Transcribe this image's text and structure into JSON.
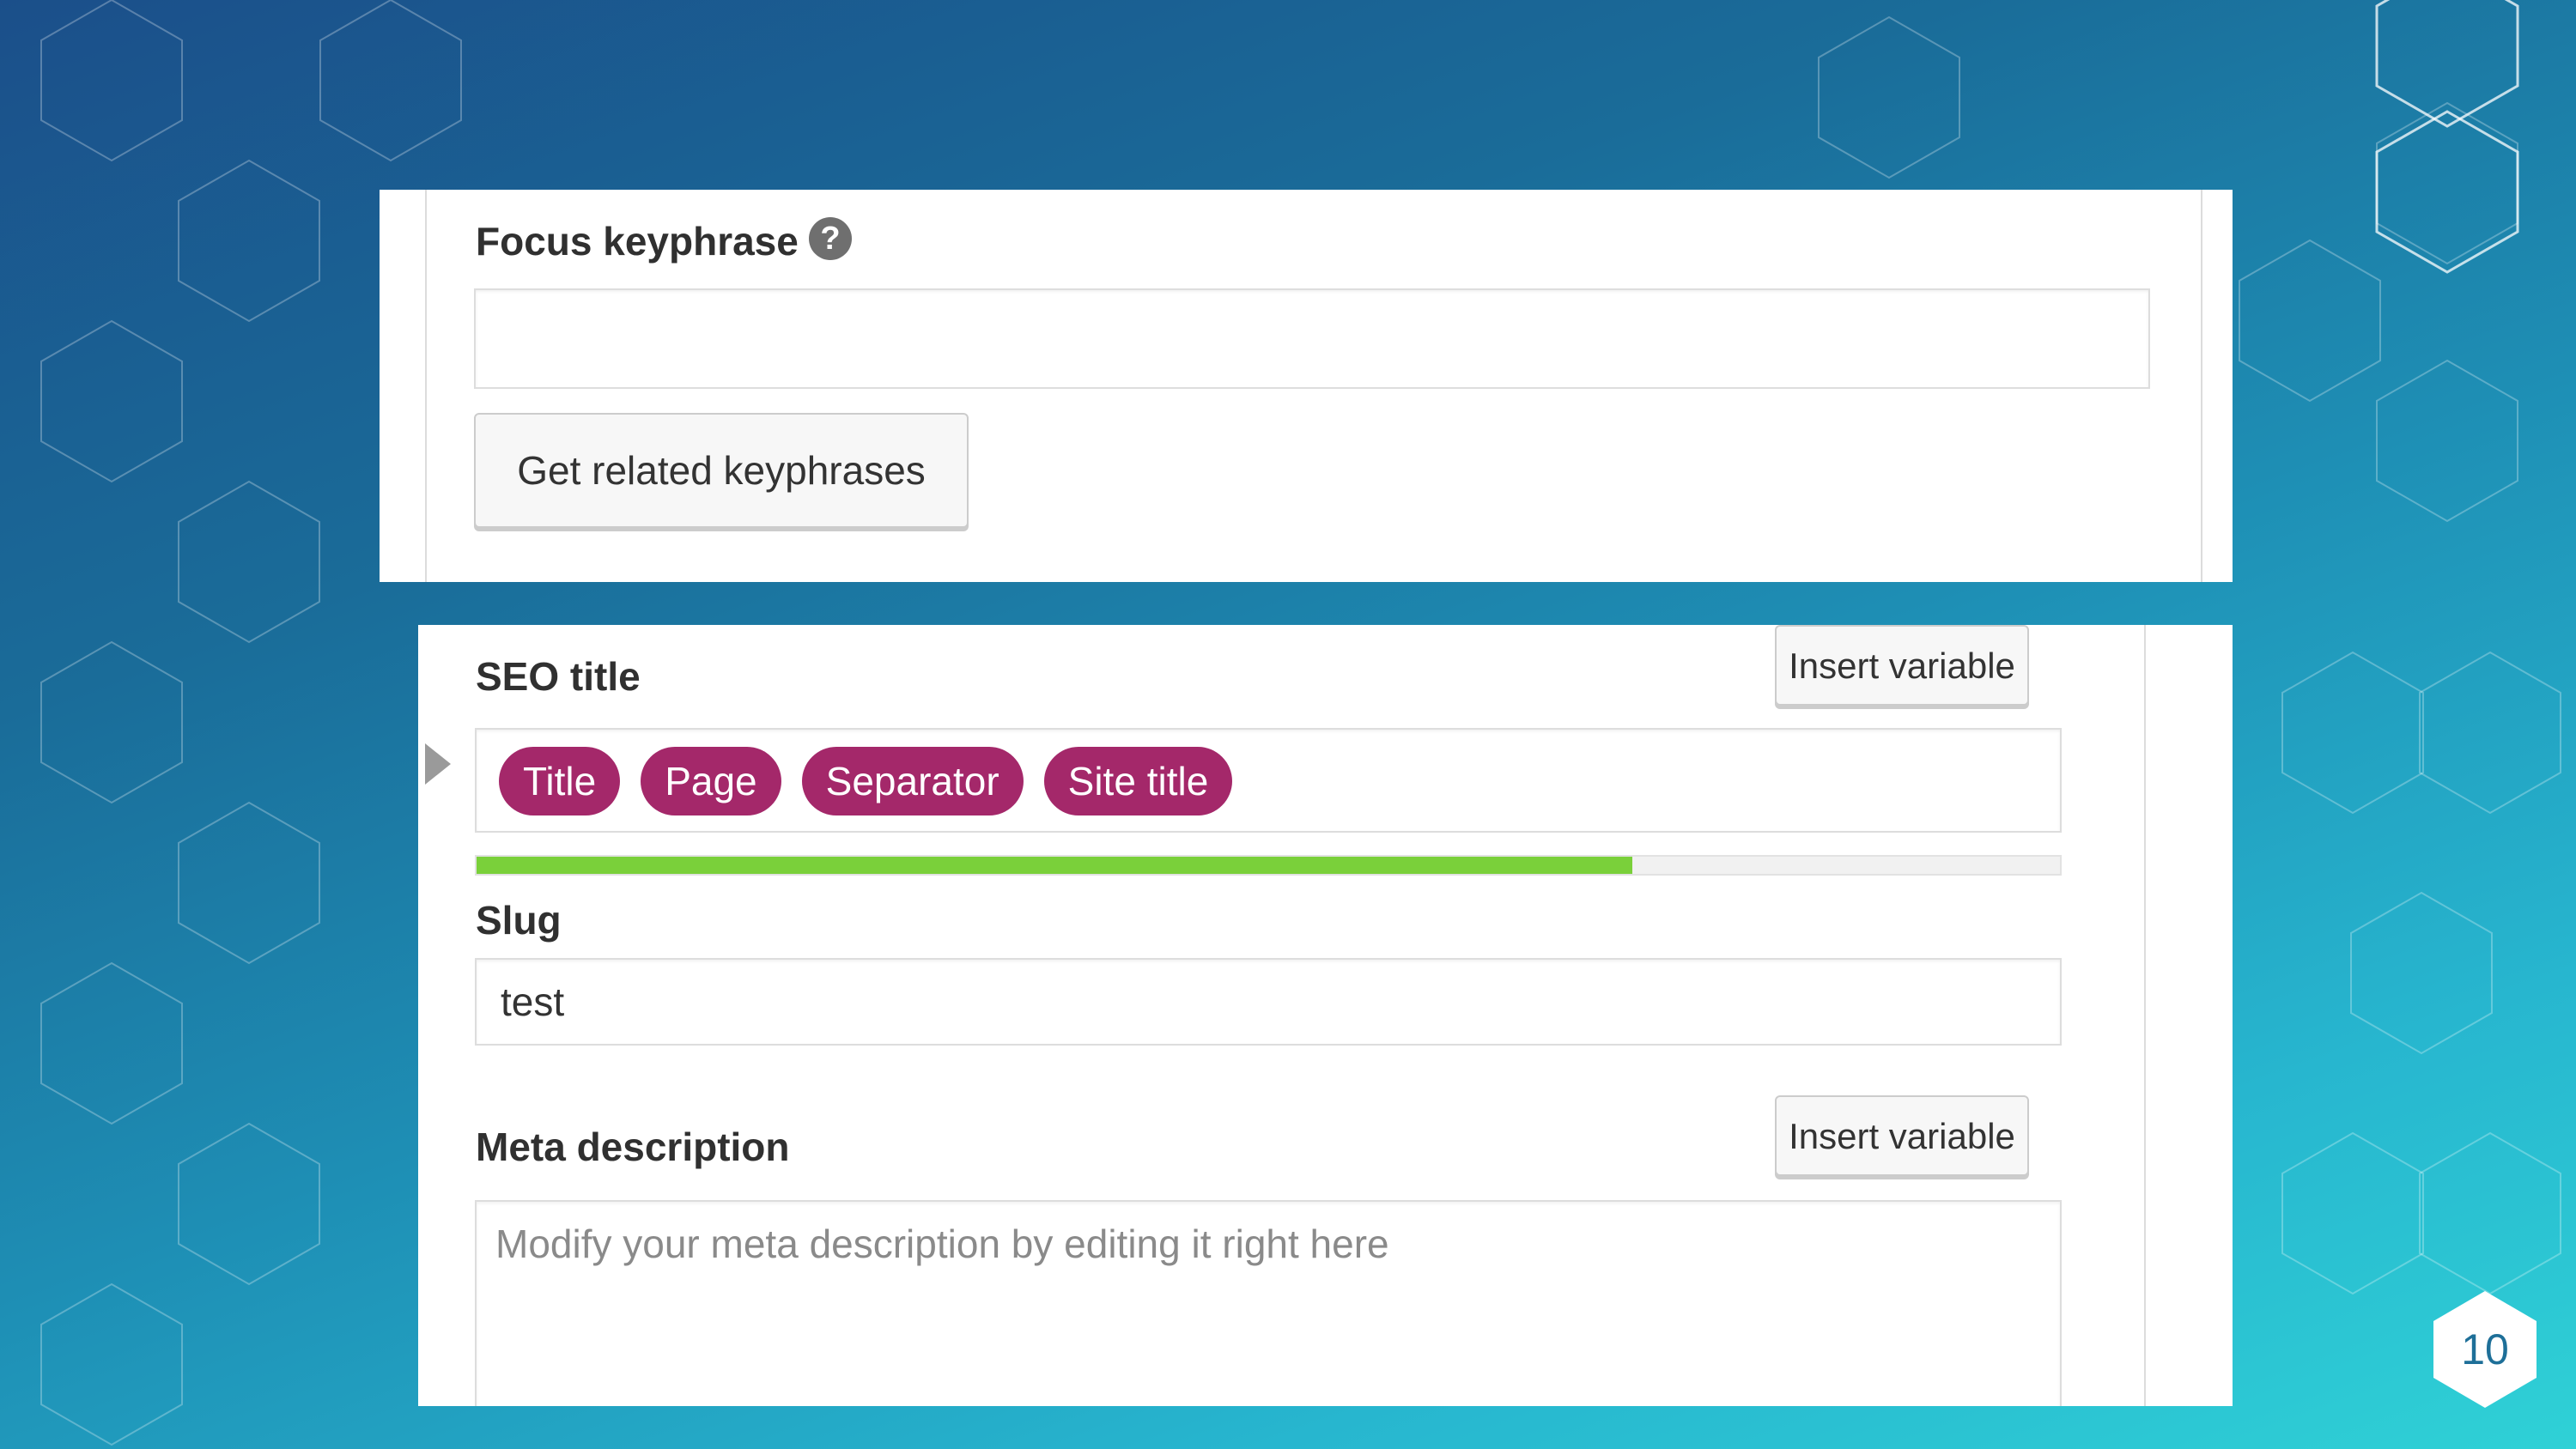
{
  "focus_keyphrase": {
    "label": "Focus keyphrase",
    "help_icon": "question-circle-icon",
    "value": "",
    "related_button_label": "Get related keyphrases"
  },
  "seo_title": {
    "label": "SEO title",
    "insert_variable_label": "Insert variable",
    "variables": [
      "Title",
      "Page",
      "Separator",
      "Site title"
    ],
    "progress_fraction": 0.73,
    "progress_color": "#7ad03a",
    "pill_color": "#a4286a"
  },
  "slug": {
    "label": "Slug",
    "value": "test"
  },
  "meta_description": {
    "label": "Meta description",
    "insert_variable_label": "Insert variable",
    "placeholder": "Modify your meta description by editing it right here"
  },
  "collapse_icon": "caret-right-icon",
  "slide": {
    "page_number": "10"
  }
}
